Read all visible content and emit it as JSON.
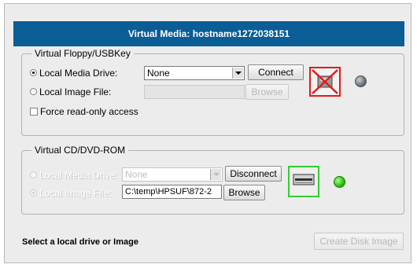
{
  "window": {
    "title": "Virtual Media: hostname1272038151"
  },
  "floppy": {
    "group_title": "Virtual Floppy/USBKey",
    "local_media_drive_label": "Local Media Drive:",
    "local_media_drive_value": "None",
    "connect_label": "Connect",
    "local_image_file_label": "Local Image File:",
    "image_file_value": "",
    "browse_label": "Browse",
    "force_readonly_label": "Force read-only access",
    "status_icon": "floppy-disconnected-icon",
    "status_led_color": "#6b7478"
  },
  "cdrom": {
    "group_title": "Virtual CD/DVD-ROM",
    "local_media_drive_label": "Local Media Drive:",
    "local_media_drive_value": "None",
    "disconnect_label": "Disconnect",
    "local_image_file_label": "Local Image File:",
    "image_file_value": "C:\\temp\\HPSUF\\872-2",
    "browse_label": "Browse",
    "status_icon": "cdrom-connected-icon",
    "status_led_color": "#22c400"
  },
  "footer": {
    "status_text": "Select a local drive or Image",
    "create_disk_image_label": "Create Disk Image"
  }
}
